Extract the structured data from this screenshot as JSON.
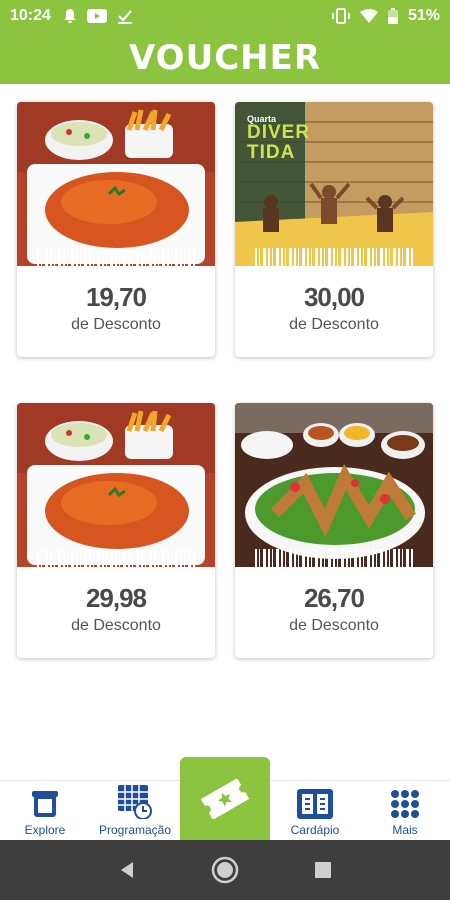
{
  "status_bar": {
    "time": "10:24",
    "battery": "51%"
  },
  "header": {
    "title": "VOUCHER"
  },
  "vouchers": [
    {
      "amount": "19,70",
      "label": "de Desconto",
      "image": "food-plate-image"
    },
    {
      "amount": "30,00",
      "label": "de Desconto",
      "image": "water-park-image",
      "image_text": {
        "day": "Quarta",
        "title_line1": "DIVER",
        "title_line2": "TIDA"
      }
    },
    {
      "amount": "29,98",
      "label": "de Desconto",
      "image": "food-plate-image"
    },
    {
      "amount": "26,70",
      "label": "de Desconto",
      "image": "grilled-dish-image"
    }
  ],
  "bottom_nav": {
    "items": [
      {
        "label": "Explore",
        "icon": "explore-icon"
      },
      {
        "label": "Programação",
        "icon": "calendar-icon"
      },
      {
        "label": "",
        "icon": "ticket-icon"
      },
      {
        "label": "Cardápio",
        "icon": "menu-book-icon"
      },
      {
        "label": "Mais",
        "icon": "grid-dots-icon"
      }
    ]
  },
  "colors": {
    "brand_green": "#8cc33f",
    "nav_blue": "#1f4e9a",
    "text_gray": "#4a4a4a"
  }
}
